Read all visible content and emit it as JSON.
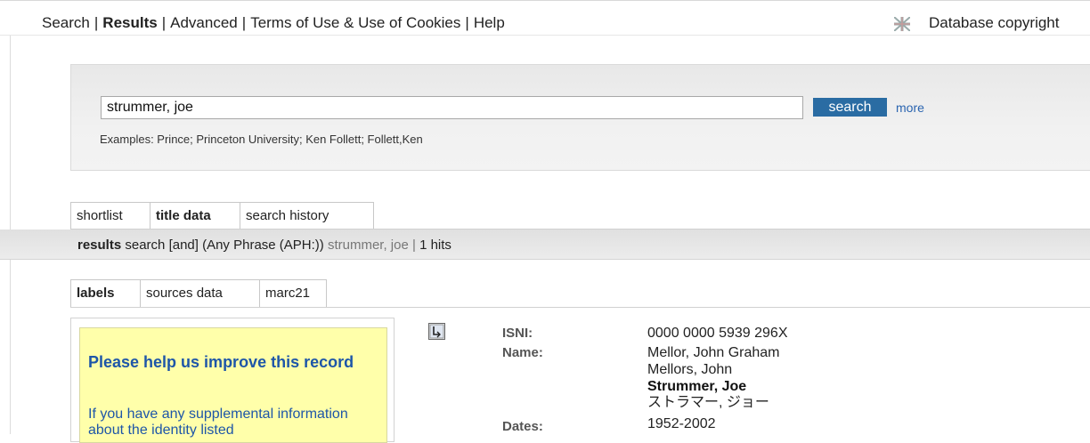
{
  "nav": {
    "links": [
      "Search",
      "Results",
      "Advanced",
      "Terms of Use & Use of Cookies",
      "Help"
    ],
    "db_copyright": "Database copyright"
  },
  "search": {
    "value": "strummer, joe",
    "button": "search",
    "more": "more",
    "examples": "Examples: Prince; Princeton University; Ken Follett; Follett,Ken"
  },
  "tabs_top": [
    "shortlist",
    "title data",
    "search history"
  ],
  "results_bar": {
    "label": "results",
    "query": "search [and]  (Any Phrase (APH:))",
    "term": "strummer, joe",
    "sep": "|",
    "hits": "1 hits"
  },
  "tabs_record": [
    "labels",
    "sources data",
    "marc21"
  ],
  "help": {
    "title": "Please help us improve this record",
    "text": "If you have any supplemental information about the identity listed"
  },
  "record": {
    "isni_label": "ISNI:",
    "isni": "0000 0000 5939 296X",
    "name_label": "Name:",
    "names": [
      "Mellor, John Graham",
      "Mellors, John",
      "Strummer, Joe",
      "ストラマー, ジョー"
    ],
    "dates_label": "Dates:",
    "dates": "1952-2002"
  }
}
